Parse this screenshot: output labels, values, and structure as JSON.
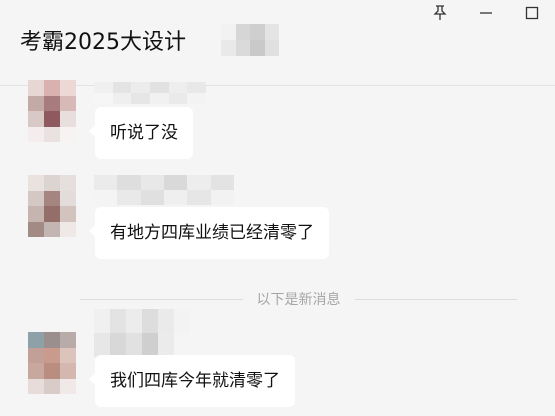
{
  "window": {
    "controls": [
      {
        "name": "pin-icon"
      },
      {
        "name": "minimize-icon"
      },
      {
        "name": "maximize-icon"
      }
    ]
  },
  "header": {
    "title": "考霸2025大设计"
  },
  "messages": [
    {
      "text": "听说了没"
    },
    {
      "text": "有地方四库业绩已经清零了"
    },
    {
      "text": "我们四库今年就清零了"
    }
  ],
  "divider": {
    "text": "以下是新消息"
  },
  "colors": {
    "background": "#f5f5f5",
    "bubble": "#ffffff",
    "divider_text": "#a6a6a6"
  }
}
